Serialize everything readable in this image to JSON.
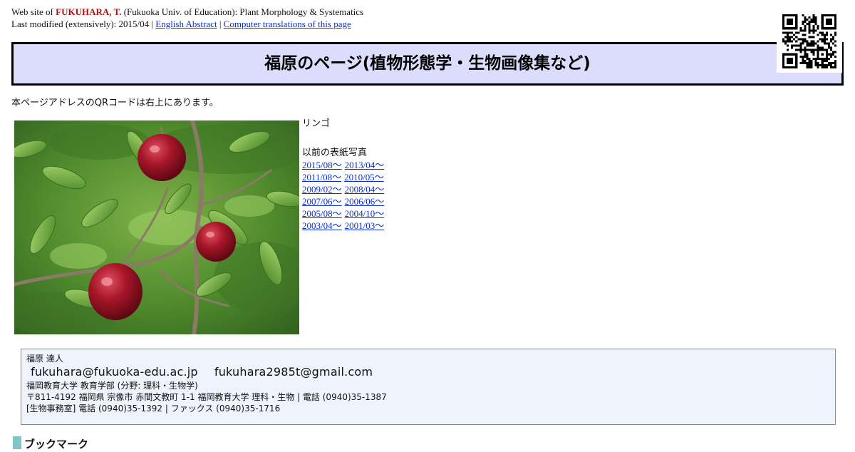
{
  "header": {
    "prefix": "Web site of ",
    "name": "FUKUHARA, T.",
    "affiliation": " (Fukuoka Univ. of Education): Plant Morphology & Systematics",
    "modified_text": "Last modified (extensively): 2015/04 | ",
    "english_abstract_link": "English Abstract",
    "separator": " | ",
    "translations_link": "Computer translations of this page"
  },
  "title": "福原のページ(植物形態学・生物画像集など)",
  "qr_note": "本ページアドレスのQRコードは右上にあります。",
  "cover": {
    "subject": "リンゴ",
    "past_title": "以前の表紙写真",
    "past_links": [
      [
        "2015/08～",
        "2013/04～"
      ],
      [
        "2011/08～",
        "2010/05～"
      ],
      [
        "2009/02～",
        "2008/04～"
      ],
      [
        "2007/06～",
        "2006/06～"
      ],
      [
        "2005/08～",
        "2004/10～"
      ],
      [
        "2003/04～",
        "2001/03～"
      ]
    ]
  },
  "contact": {
    "name": "福原 達人",
    "email1": "fukuhara@fukuoka-edu.ac.jp",
    "email2": "fukuhara2985t@gmail.com",
    "dept": "福岡教育大学 教育学部 (分野: 理科・生物学)",
    "address": "〒811-4192 福岡県 宗像市 赤間文教町 1-1 福岡教育大学 理科・生物 | 電話 (0940)35-1387",
    "office": "[生物事務室] 電話 (0940)35-1392 | ファックス (0940)35-1716"
  },
  "bookmark_heading": "ブックマーク",
  "colors": {
    "title_bg": "#dcdcfc",
    "name_red": "#b01010",
    "link_blue": "#0b2ecc",
    "contact_bg": "#eef4fc",
    "bookmark_marker": "#7fc7c7"
  }
}
